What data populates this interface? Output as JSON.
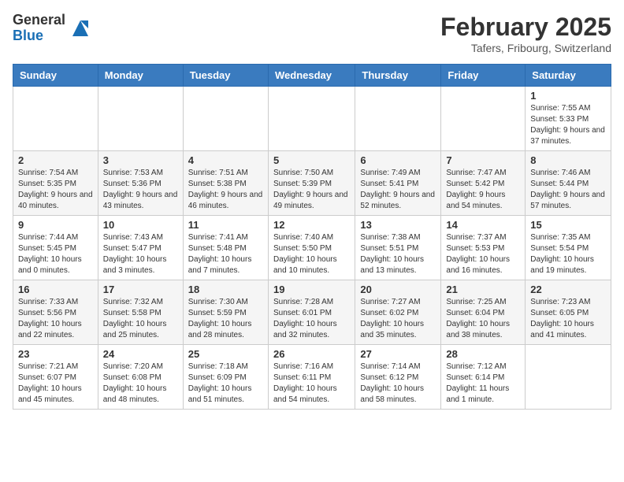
{
  "header": {
    "logo_general": "General",
    "logo_blue": "Blue",
    "month_year": "February 2025",
    "location": "Tafers, Fribourg, Switzerland"
  },
  "weekdays": [
    "Sunday",
    "Monday",
    "Tuesday",
    "Wednesday",
    "Thursday",
    "Friday",
    "Saturday"
  ],
  "weeks": [
    [
      {
        "day": "",
        "info": ""
      },
      {
        "day": "",
        "info": ""
      },
      {
        "day": "",
        "info": ""
      },
      {
        "day": "",
        "info": ""
      },
      {
        "day": "",
        "info": ""
      },
      {
        "day": "",
        "info": ""
      },
      {
        "day": "1",
        "info": "Sunrise: 7:55 AM\nSunset: 5:33 PM\nDaylight: 9 hours and 37 minutes."
      }
    ],
    [
      {
        "day": "2",
        "info": "Sunrise: 7:54 AM\nSunset: 5:35 PM\nDaylight: 9 hours and 40 minutes."
      },
      {
        "day": "3",
        "info": "Sunrise: 7:53 AM\nSunset: 5:36 PM\nDaylight: 9 hours and 43 minutes."
      },
      {
        "day": "4",
        "info": "Sunrise: 7:51 AM\nSunset: 5:38 PM\nDaylight: 9 hours and 46 minutes."
      },
      {
        "day": "5",
        "info": "Sunrise: 7:50 AM\nSunset: 5:39 PM\nDaylight: 9 hours and 49 minutes."
      },
      {
        "day": "6",
        "info": "Sunrise: 7:49 AM\nSunset: 5:41 PM\nDaylight: 9 hours and 52 minutes."
      },
      {
        "day": "7",
        "info": "Sunrise: 7:47 AM\nSunset: 5:42 PM\nDaylight: 9 hours and 54 minutes."
      },
      {
        "day": "8",
        "info": "Sunrise: 7:46 AM\nSunset: 5:44 PM\nDaylight: 9 hours and 57 minutes."
      }
    ],
    [
      {
        "day": "9",
        "info": "Sunrise: 7:44 AM\nSunset: 5:45 PM\nDaylight: 10 hours and 0 minutes."
      },
      {
        "day": "10",
        "info": "Sunrise: 7:43 AM\nSunset: 5:47 PM\nDaylight: 10 hours and 3 minutes."
      },
      {
        "day": "11",
        "info": "Sunrise: 7:41 AM\nSunset: 5:48 PM\nDaylight: 10 hours and 7 minutes."
      },
      {
        "day": "12",
        "info": "Sunrise: 7:40 AM\nSunset: 5:50 PM\nDaylight: 10 hours and 10 minutes."
      },
      {
        "day": "13",
        "info": "Sunrise: 7:38 AM\nSunset: 5:51 PM\nDaylight: 10 hours and 13 minutes."
      },
      {
        "day": "14",
        "info": "Sunrise: 7:37 AM\nSunset: 5:53 PM\nDaylight: 10 hours and 16 minutes."
      },
      {
        "day": "15",
        "info": "Sunrise: 7:35 AM\nSunset: 5:54 PM\nDaylight: 10 hours and 19 minutes."
      }
    ],
    [
      {
        "day": "16",
        "info": "Sunrise: 7:33 AM\nSunset: 5:56 PM\nDaylight: 10 hours and 22 minutes."
      },
      {
        "day": "17",
        "info": "Sunrise: 7:32 AM\nSunset: 5:58 PM\nDaylight: 10 hours and 25 minutes."
      },
      {
        "day": "18",
        "info": "Sunrise: 7:30 AM\nSunset: 5:59 PM\nDaylight: 10 hours and 28 minutes."
      },
      {
        "day": "19",
        "info": "Sunrise: 7:28 AM\nSunset: 6:01 PM\nDaylight: 10 hours and 32 minutes."
      },
      {
        "day": "20",
        "info": "Sunrise: 7:27 AM\nSunset: 6:02 PM\nDaylight: 10 hours and 35 minutes."
      },
      {
        "day": "21",
        "info": "Sunrise: 7:25 AM\nSunset: 6:04 PM\nDaylight: 10 hours and 38 minutes."
      },
      {
        "day": "22",
        "info": "Sunrise: 7:23 AM\nSunset: 6:05 PM\nDaylight: 10 hours and 41 minutes."
      }
    ],
    [
      {
        "day": "23",
        "info": "Sunrise: 7:21 AM\nSunset: 6:07 PM\nDaylight: 10 hours and 45 minutes."
      },
      {
        "day": "24",
        "info": "Sunrise: 7:20 AM\nSunset: 6:08 PM\nDaylight: 10 hours and 48 minutes."
      },
      {
        "day": "25",
        "info": "Sunrise: 7:18 AM\nSunset: 6:09 PM\nDaylight: 10 hours and 51 minutes."
      },
      {
        "day": "26",
        "info": "Sunrise: 7:16 AM\nSunset: 6:11 PM\nDaylight: 10 hours and 54 minutes."
      },
      {
        "day": "27",
        "info": "Sunrise: 7:14 AM\nSunset: 6:12 PM\nDaylight: 10 hours and 58 minutes."
      },
      {
        "day": "28",
        "info": "Sunrise: 7:12 AM\nSunset: 6:14 PM\nDaylight: 11 hours and 1 minute."
      },
      {
        "day": "",
        "info": ""
      }
    ]
  ]
}
